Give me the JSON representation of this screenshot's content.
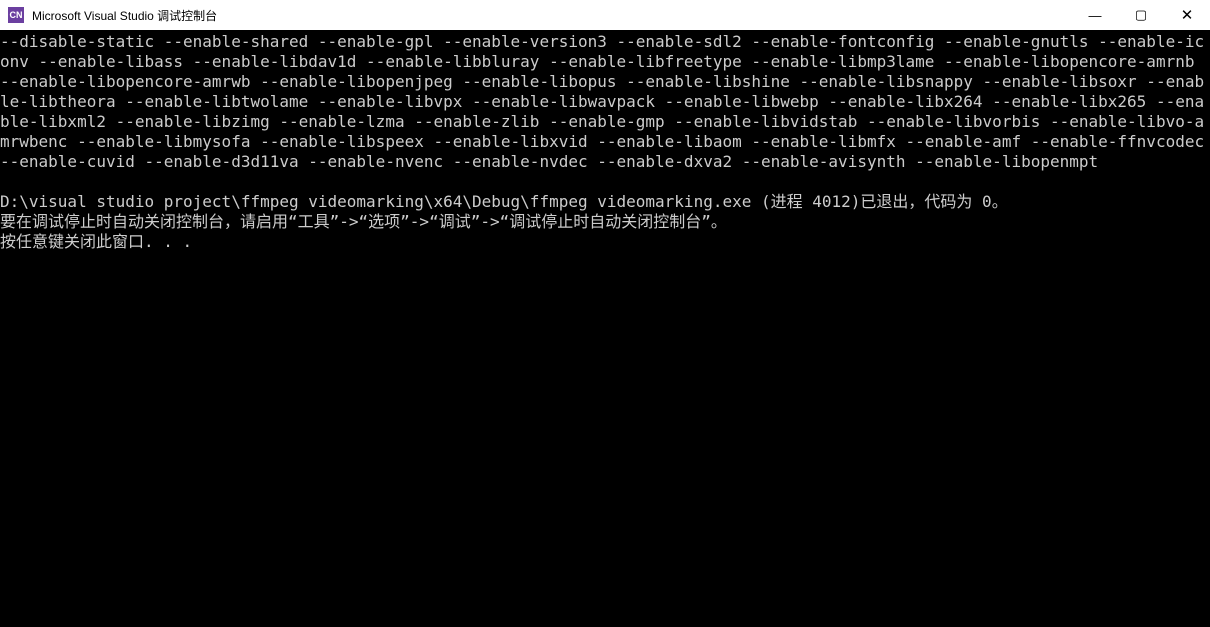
{
  "titlebar": {
    "icon_label": "CN",
    "title": "Microsoft Visual Studio 调试控制台"
  },
  "window_controls": {
    "minimize": "—",
    "maximize": "▢",
    "close": "✕"
  },
  "console": {
    "flags": "--disable-static --enable-shared --enable-gpl --enable-version3 --enable-sdl2 --enable-fontconfig --enable-gnutls --enable-iconv --enable-libass --enable-libdav1d --enable-libbluray --enable-libfreetype --enable-libmp3lame --enable-libopencore-amrnb --enable-libopencore-amrwb --enable-libopenjpeg --enable-libopus --enable-libshine --enable-libsnappy --enable-libsoxr --enable-libtheora --enable-libtwolame --enable-libvpx --enable-libwavpack --enable-libwebp --enable-libx264 --enable-libx265 --enable-libxml2 --enable-libzimg --enable-lzma --enable-zlib --enable-gmp --enable-libvidstab --enable-libvorbis --enable-libvo-amrwbenc --enable-libmysofa --enable-libspeex --enable-libxvid --enable-libaom --enable-libmfx --enable-amf --enable-ffnvcodec --enable-cuvid --enable-d3d11va --enable-nvenc --enable-nvdec --enable-dxva2 --enable-avisynth --enable-libopenmpt",
    "exit_line": "D:\\visual studio project\\ffmpeg videomarking\\x64\\Debug\\ffmpeg videomarking.exe (进程 4012)已退出，代码为 0。",
    "hint_line": "要在调试停止时自动关闭控制台，请启用“工具”->“选项”->“调试”->“调试停止时自动关闭控制台”。",
    "press_key_line": "按任意键关闭此窗口. . ."
  }
}
